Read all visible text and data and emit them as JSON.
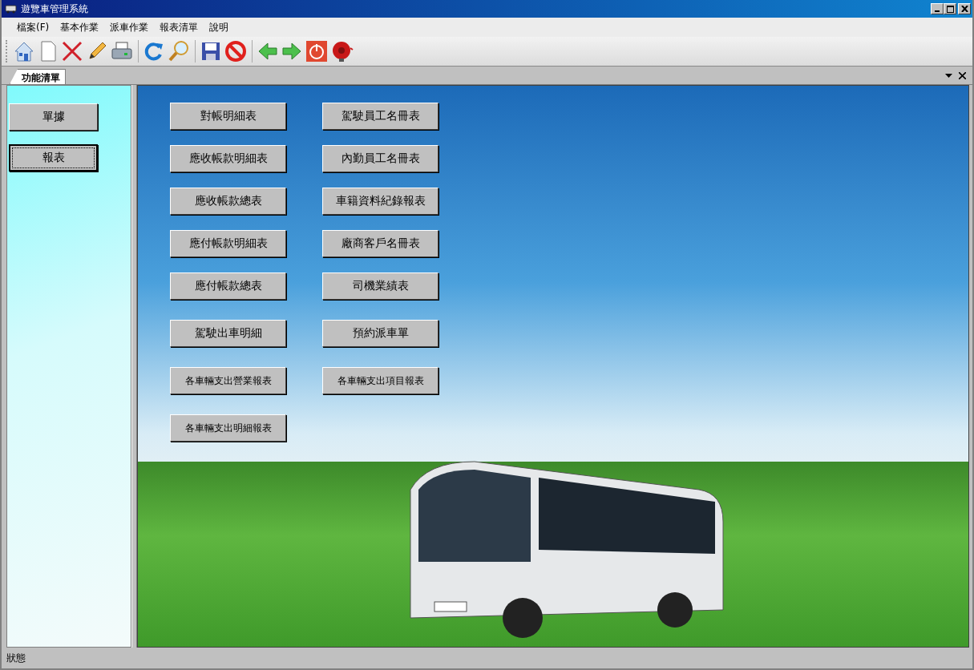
{
  "window": {
    "title": "遊覽車管理系統"
  },
  "menu": [
    "檔案(F)",
    "基本作業",
    "派車作業",
    "報表清單",
    "說明"
  ],
  "tabs": [
    {
      "label": "功能清單",
      "selected": true
    }
  ],
  "sidebar": {
    "buttons": [
      {
        "label": "單據",
        "selected": false
      },
      {
        "label": "報表",
        "selected": true
      }
    ]
  },
  "report_buttons": [
    {
      "label": "對帳明細表"
    },
    {
      "label": "駕駛員工名冊表"
    },
    {
      "label": "應收帳款明細表"
    },
    {
      "label": "內勤員工名冊表"
    },
    {
      "label": "應收帳款總表"
    },
    {
      "label": "車籍資料紀錄報表"
    },
    {
      "label": "應付帳款明細表"
    },
    {
      "label": "廠商客戶名冊表"
    },
    {
      "label": "應付帳款總表"
    },
    {
      "label": "司機業績表"
    },
    {
      "label": "駕駛出車明細"
    },
    {
      "label": "預約派車單"
    },
    {
      "label": "各車輛支出營業報表",
      "small": true
    },
    {
      "label": "各車輛支出項目報表",
      "small": true
    },
    {
      "label": "各車輛支出明細報表",
      "small": true
    }
  ],
  "status_bar": {
    "text": "狀態"
  }
}
